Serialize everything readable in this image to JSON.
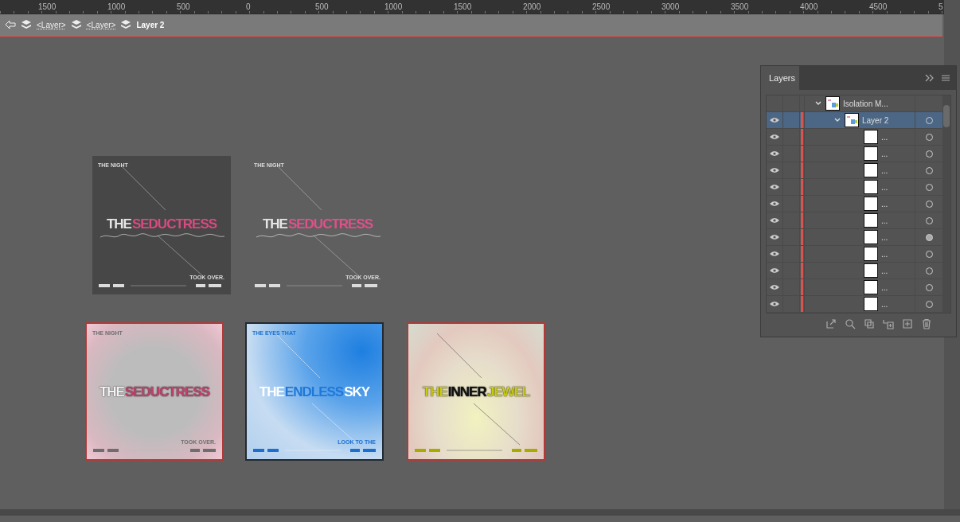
{
  "ruler": {
    "labels": [
      "1500",
      "1000",
      "500",
      "0",
      "500",
      "1000",
      "1500",
      "2000",
      "2500",
      "3000",
      "3500",
      "4000",
      "4500",
      "5"
    ]
  },
  "breadcrumb": [
    {
      "label": "<Layer>",
      "current": false
    },
    {
      "label": "<Layer>",
      "current": false
    },
    {
      "label": "Layer 2",
      "current": true
    }
  ],
  "artboards": [
    {
      "kind": "dark",
      "top_text": "THE NIGHT",
      "title": [
        {
          "text": "THE",
          "color": "#e6e6e6"
        },
        {
          "text": "SEDUCTRESS",
          "color": "#d84a80"
        }
      ],
      "bottom_text": "TOOK OVER."
    },
    {
      "kind": "clear",
      "top_text": "THE NIGHT",
      "title": [
        {
          "text": "THE",
          "color": "#e6e6e6"
        },
        {
          "text": "SEDUCTRESS",
          "color": "#e0508a"
        }
      ],
      "bottom_text": "TOOK OVER."
    },
    {
      "kind": "pink",
      "top_text": "THE NIGHT",
      "title": [
        {
          "text": "THE",
          "color": "#f4f4f4"
        },
        {
          "text": "SEDUCTRESS",
          "color": "#c2416e"
        }
      ],
      "bottom_text": "TOOK OVER."
    },
    {
      "kind": "blue",
      "top_text": "THE EYES THAT",
      "title": [
        {
          "text": "THE",
          "color": "#ffffff"
        },
        {
          "text": "ENDLESS",
          "color": "#1f78d8"
        },
        {
          "text": "SKY",
          "color": "#ffffff"
        }
      ],
      "bottom_text": "LOOK TO THE"
    },
    {
      "kind": "cream",
      "title": [
        {
          "text": "THE",
          "color": "#c9cc10"
        },
        {
          "text": "INNER",
          "color": "#111111"
        },
        {
          "text": "JEWEL",
          "color": "#c9cc10"
        }
      ]
    }
  ],
  "layers_panel": {
    "tab": "Layers",
    "layers": [
      {
        "name": "Isolation M...",
        "expanded": true,
        "selected": false,
        "children": [
          {
            "name": "Layer 2",
            "expanded": true,
            "selected": true,
            "visible": true,
            "targeted": false,
            "children": [
              {
                "name": "...",
                "selected": false,
                "visible": true,
                "targeted": false
              },
              {
                "name": "...",
                "selected": false,
                "visible": true,
                "targeted": false
              },
              {
                "name": "...",
                "selected": false,
                "visible": true,
                "targeted": false
              },
              {
                "name": "...",
                "selected": false,
                "visible": true,
                "targeted": false
              },
              {
                "name": "...",
                "selected": false,
                "visible": true,
                "targeted": false
              },
              {
                "name": "...",
                "selected": false,
                "visible": true,
                "targeted": false
              },
              {
                "name": "...",
                "selected": false,
                "visible": true,
                "targeted": true
              },
              {
                "name": "...",
                "selected": false,
                "visible": true,
                "targeted": false
              },
              {
                "name": "...",
                "selected": false,
                "visible": true,
                "targeted": false
              },
              {
                "name": "...",
                "selected": false,
                "visible": true,
                "targeted": false
              },
              {
                "name": "...",
                "selected": false,
                "visible": true,
                "targeted": false
              }
            ]
          }
        ]
      }
    ]
  }
}
